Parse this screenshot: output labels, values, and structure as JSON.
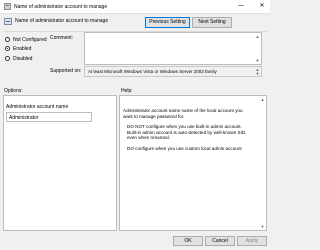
{
  "window": {
    "title": "Name of administrator account to manage",
    "minimize_glyph": "—",
    "maximize_glyph": "☐",
    "close_glyph": "✕"
  },
  "header": {
    "title": "Name of administrator account to manage",
    "icon": "policy-setting-icon"
  },
  "nav": {
    "previous_label": "Previous Setting",
    "next_label": "Next Setting"
  },
  "state": {
    "options": [
      {
        "label": "Not Configured",
        "checked": false
      },
      {
        "label": "Enabled",
        "checked": true
      },
      {
        "label": "Disabled",
        "checked": false
      }
    ]
  },
  "comment": {
    "label": "Comment:",
    "value": ""
  },
  "supported_on": {
    "label": "Supported on:",
    "value": "At least Microsoft Windows Vista or Windows Server 2003 family"
  },
  "options_panel": {
    "title": "Options:",
    "field_label": "Administrator account name",
    "field_value": "Administrator"
  },
  "help_panel": {
    "title": "Help:",
    "paragraphs": [
      "Administrator account name name of the local account you want to manage password for.",
      "DO NOT configure when you use built-in admin account. Built-in admin account is auto-detected by well-known SID, even when renamed.",
      "DO configure when you use custom local admin account"
    ]
  },
  "footer": {
    "ok_label": "OK",
    "cancel_label": "Cancel",
    "apply_label": "Apply"
  }
}
